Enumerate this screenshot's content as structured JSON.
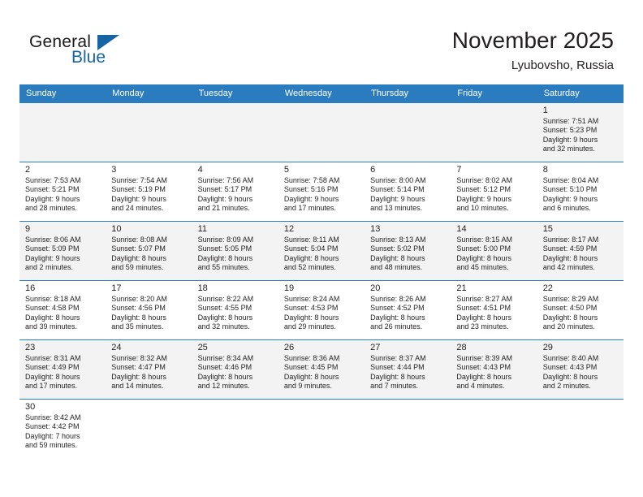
{
  "brand": {
    "line1": "General",
    "line2": "Blue",
    "flag_icon": "triangle-flag-icon",
    "accent_color": "#1565a6"
  },
  "header": {
    "title": "November 2025",
    "subtitle": "Lyubovsho, Russia"
  },
  "theme": {
    "header_row_bg": "#2b7cbf",
    "shaded_row_bg": "#f3f3f3",
    "text_color": "#231f20"
  },
  "weekdays": [
    "Sunday",
    "Monday",
    "Tuesday",
    "Wednesday",
    "Thursday",
    "Friday",
    "Saturday"
  ],
  "weeks": [
    [
      {
        "empty": true
      },
      {
        "empty": true
      },
      {
        "empty": true
      },
      {
        "empty": true
      },
      {
        "empty": true
      },
      {
        "empty": true
      },
      {
        "day": "1",
        "sunrise": "Sunrise: 7:51 AM",
        "sunset": "Sunset: 5:23 PM",
        "daylight1": "Daylight: 9 hours",
        "daylight2": "and 32 minutes."
      }
    ],
    [
      {
        "day": "2",
        "sunrise": "Sunrise: 7:53 AM",
        "sunset": "Sunset: 5:21 PM",
        "daylight1": "Daylight: 9 hours",
        "daylight2": "and 28 minutes."
      },
      {
        "day": "3",
        "sunrise": "Sunrise: 7:54 AM",
        "sunset": "Sunset: 5:19 PM",
        "daylight1": "Daylight: 9 hours",
        "daylight2": "and 24 minutes."
      },
      {
        "day": "4",
        "sunrise": "Sunrise: 7:56 AM",
        "sunset": "Sunset: 5:17 PM",
        "daylight1": "Daylight: 9 hours",
        "daylight2": "and 21 minutes."
      },
      {
        "day": "5",
        "sunrise": "Sunrise: 7:58 AM",
        "sunset": "Sunset: 5:16 PM",
        "daylight1": "Daylight: 9 hours",
        "daylight2": "and 17 minutes."
      },
      {
        "day": "6",
        "sunrise": "Sunrise: 8:00 AM",
        "sunset": "Sunset: 5:14 PM",
        "daylight1": "Daylight: 9 hours",
        "daylight2": "and 13 minutes."
      },
      {
        "day": "7",
        "sunrise": "Sunrise: 8:02 AM",
        "sunset": "Sunset: 5:12 PM",
        "daylight1": "Daylight: 9 hours",
        "daylight2": "and 10 minutes."
      },
      {
        "day": "8",
        "sunrise": "Sunrise: 8:04 AM",
        "sunset": "Sunset: 5:10 PM",
        "daylight1": "Daylight: 9 hours",
        "daylight2": "and 6 minutes."
      }
    ],
    [
      {
        "day": "9",
        "sunrise": "Sunrise: 8:06 AM",
        "sunset": "Sunset: 5:09 PM",
        "daylight1": "Daylight: 9 hours",
        "daylight2": "and 2 minutes."
      },
      {
        "day": "10",
        "sunrise": "Sunrise: 8:08 AM",
        "sunset": "Sunset: 5:07 PM",
        "daylight1": "Daylight: 8 hours",
        "daylight2": "and 59 minutes."
      },
      {
        "day": "11",
        "sunrise": "Sunrise: 8:09 AM",
        "sunset": "Sunset: 5:05 PM",
        "daylight1": "Daylight: 8 hours",
        "daylight2": "and 55 minutes."
      },
      {
        "day": "12",
        "sunrise": "Sunrise: 8:11 AM",
        "sunset": "Sunset: 5:04 PM",
        "daylight1": "Daylight: 8 hours",
        "daylight2": "and 52 minutes."
      },
      {
        "day": "13",
        "sunrise": "Sunrise: 8:13 AM",
        "sunset": "Sunset: 5:02 PM",
        "daylight1": "Daylight: 8 hours",
        "daylight2": "and 48 minutes."
      },
      {
        "day": "14",
        "sunrise": "Sunrise: 8:15 AM",
        "sunset": "Sunset: 5:00 PM",
        "daylight1": "Daylight: 8 hours",
        "daylight2": "and 45 minutes."
      },
      {
        "day": "15",
        "sunrise": "Sunrise: 8:17 AM",
        "sunset": "Sunset: 4:59 PM",
        "daylight1": "Daylight: 8 hours",
        "daylight2": "and 42 minutes."
      }
    ],
    [
      {
        "day": "16",
        "sunrise": "Sunrise: 8:18 AM",
        "sunset": "Sunset: 4:58 PM",
        "daylight1": "Daylight: 8 hours",
        "daylight2": "and 39 minutes."
      },
      {
        "day": "17",
        "sunrise": "Sunrise: 8:20 AM",
        "sunset": "Sunset: 4:56 PM",
        "daylight1": "Daylight: 8 hours",
        "daylight2": "and 35 minutes."
      },
      {
        "day": "18",
        "sunrise": "Sunrise: 8:22 AM",
        "sunset": "Sunset: 4:55 PM",
        "daylight1": "Daylight: 8 hours",
        "daylight2": "and 32 minutes."
      },
      {
        "day": "19",
        "sunrise": "Sunrise: 8:24 AM",
        "sunset": "Sunset: 4:53 PM",
        "daylight1": "Daylight: 8 hours",
        "daylight2": "and 29 minutes."
      },
      {
        "day": "20",
        "sunrise": "Sunrise: 8:26 AM",
        "sunset": "Sunset: 4:52 PM",
        "daylight1": "Daylight: 8 hours",
        "daylight2": "and 26 minutes."
      },
      {
        "day": "21",
        "sunrise": "Sunrise: 8:27 AM",
        "sunset": "Sunset: 4:51 PM",
        "daylight1": "Daylight: 8 hours",
        "daylight2": "and 23 minutes."
      },
      {
        "day": "22",
        "sunrise": "Sunrise: 8:29 AM",
        "sunset": "Sunset: 4:50 PM",
        "daylight1": "Daylight: 8 hours",
        "daylight2": "and 20 minutes."
      }
    ],
    [
      {
        "day": "23",
        "sunrise": "Sunrise: 8:31 AM",
        "sunset": "Sunset: 4:49 PM",
        "daylight1": "Daylight: 8 hours",
        "daylight2": "and 17 minutes."
      },
      {
        "day": "24",
        "sunrise": "Sunrise: 8:32 AM",
        "sunset": "Sunset: 4:47 PM",
        "daylight1": "Daylight: 8 hours",
        "daylight2": "and 14 minutes."
      },
      {
        "day": "25",
        "sunrise": "Sunrise: 8:34 AM",
        "sunset": "Sunset: 4:46 PM",
        "daylight1": "Daylight: 8 hours",
        "daylight2": "and 12 minutes."
      },
      {
        "day": "26",
        "sunrise": "Sunrise: 8:36 AM",
        "sunset": "Sunset: 4:45 PM",
        "daylight1": "Daylight: 8 hours",
        "daylight2": "and 9 minutes."
      },
      {
        "day": "27",
        "sunrise": "Sunrise: 8:37 AM",
        "sunset": "Sunset: 4:44 PM",
        "daylight1": "Daylight: 8 hours",
        "daylight2": "and 7 minutes."
      },
      {
        "day": "28",
        "sunrise": "Sunrise: 8:39 AM",
        "sunset": "Sunset: 4:43 PM",
        "daylight1": "Daylight: 8 hours",
        "daylight2": "and 4 minutes."
      },
      {
        "day": "29",
        "sunrise": "Sunrise: 8:40 AM",
        "sunset": "Sunset: 4:43 PM",
        "daylight1": "Daylight: 8 hours",
        "daylight2": "and 2 minutes."
      }
    ],
    [
      {
        "day": "30",
        "sunrise": "Sunrise: 8:42 AM",
        "sunset": "Sunset: 4:42 PM",
        "daylight1": "Daylight: 7 hours",
        "daylight2": "and 59 minutes."
      },
      {
        "empty": true
      },
      {
        "empty": true
      },
      {
        "empty": true
      },
      {
        "empty": true
      },
      {
        "empty": true
      },
      {
        "empty": true
      }
    ]
  ]
}
